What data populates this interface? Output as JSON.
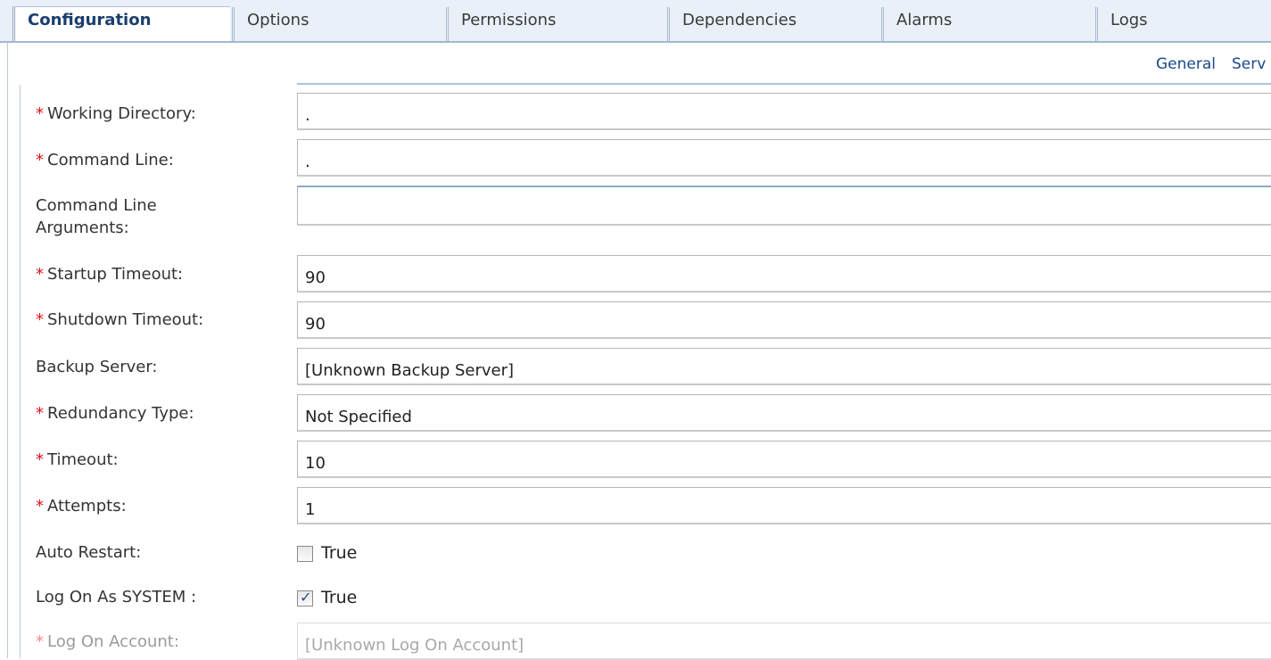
{
  "tabs": [
    "Configuration",
    "Options",
    "Permissions",
    "Dependencies",
    "Alarms",
    "Logs"
  ],
  "subnav": {
    "general": "General",
    "serv": "Serv"
  },
  "fields": {
    "working_directory": {
      "label": "Working Directory:",
      "value": "."
    },
    "command_line": {
      "label": "Command Line:",
      "value": "."
    },
    "command_line_arguments": {
      "label_line1": "Command Line",
      "label_line2": "Arguments:",
      "value": ""
    },
    "startup_timeout": {
      "label": "Startup Timeout:",
      "value": "90"
    },
    "shutdown_timeout": {
      "label": "Shutdown Timeout:",
      "value": "90"
    },
    "backup_server": {
      "label": "Backup Server:",
      "value": "[Unknown Backup Server]"
    },
    "redundancy_type": {
      "label": "Redundancy Type:",
      "value": "Not Specified"
    },
    "timeout": {
      "label": "Timeout:",
      "value": "10"
    },
    "attempts": {
      "label": "Attempts:",
      "value": "1"
    },
    "auto_restart": {
      "label": "Auto Restart:",
      "checked": false,
      "text": "True"
    },
    "log_on_as_system": {
      "label": "Log On As SYSTEM :",
      "checked": true,
      "text": "True"
    },
    "log_on_account": {
      "label": "Log On Account:",
      "value": "[Unknown Log On Account]"
    }
  },
  "required_marker": "*",
  "colors": {
    "required": "#e0121e",
    "link": "#1a4a8a",
    "active_tab_text": "#1a3e6e"
  }
}
